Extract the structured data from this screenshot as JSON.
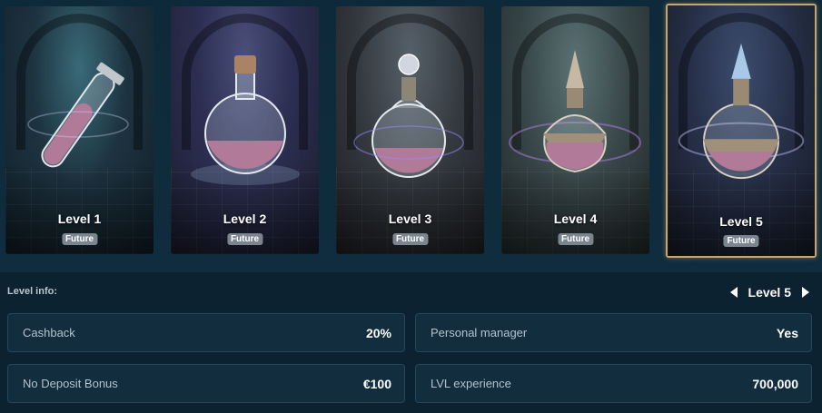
{
  "levels": [
    {
      "name": "Level 1",
      "status": "Future",
      "potion": "test-tube-potion"
    },
    {
      "name": "Level 2",
      "status": "Future",
      "potion": "round-flask-potion"
    },
    {
      "name": "Level 3",
      "status": "Future",
      "potion": "orb-flask-potion"
    },
    {
      "name": "Level 4",
      "status": "Future",
      "potion": "ornate-flask-potion"
    },
    {
      "name": "Level 5",
      "status": "Future",
      "potion": "crystal-flask-potion"
    }
  ],
  "selected_level": 5,
  "level_info": {
    "label": "Level info:",
    "current": "Level 5"
  },
  "stats": {
    "cashback": {
      "label": "Cashback",
      "value": "20%"
    },
    "personal_manager": {
      "label": "Personal manager",
      "value": "Yes"
    },
    "no_deposit_bonus": {
      "label": "No Deposit Bonus",
      "value": "€100"
    },
    "lvl_experience": {
      "label": "LVL experience",
      "value": "700,000"
    }
  },
  "colors": {
    "background": "#0c2230",
    "panel": "#122d3e",
    "panel_border": "#24475a",
    "selected_border": "#c9a56a",
    "badge": "#7b8590",
    "potion_liquid": "#b07a98"
  }
}
